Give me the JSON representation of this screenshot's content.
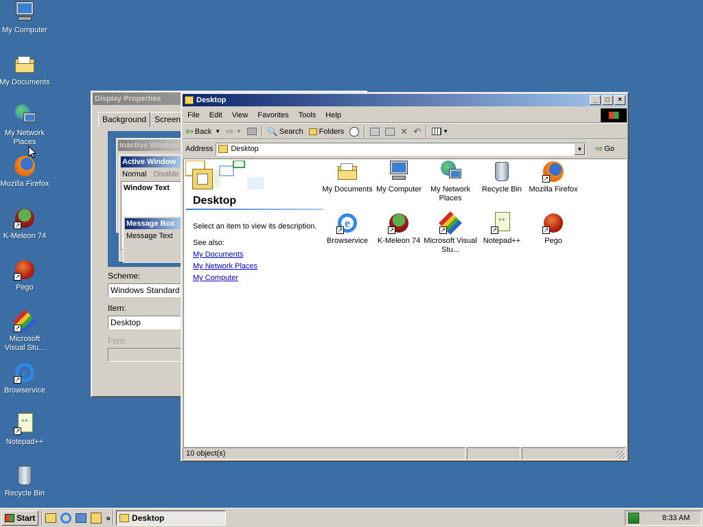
{
  "desktop_icons": [
    {
      "label": "My Computer",
      "icon": "computer-icon",
      "shortcut": false
    },
    {
      "label": "My Documents",
      "icon": "folder-icon",
      "shortcut": false
    },
    {
      "label": "My Network Places",
      "icon": "network-icon",
      "shortcut": false
    },
    {
      "label": "Mozilla Firefox",
      "icon": "firefox-icon",
      "shortcut": false
    },
    {
      "label": "K-Meleon 74",
      "icon": "kmeleon-icon",
      "shortcut": true
    },
    {
      "label": "Pego",
      "icon": "pego-icon",
      "shortcut": true
    },
    {
      "label": "Microsoft Visual Stu...",
      "icon": "visual-studio-icon",
      "shortcut": true
    },
    {
      "label": "Browservice",
      "icon": "ie-icon",
      "shortcut": true
    },
    {
      "label": "Notepad++",
      "icon": "notepad-icon",
      "shortcut": true
    },
    {
      "label": "Recycle Bin",
      "icon": "recycle-bin-icon",
      "shortcut": false
    }
  ],
  "display_props": {
    "title": "Display Properties",
    "tabs": [
      "Background",
      "Screen S"
    ],
    "preview": {
      "inactive_window": "Inactive Window",
      "active_window": "Active Window",
      "menu_normal": "Normal",
      "menu_disabled": "Disable",
      "window_text": "Window Text",
      "message_box": "Message Box",
      "message_text": "Message Text"
    },
    "scheme_label": "Scheme:",
    "scheme_value": "Windows Standard",
    "item_label": "Item:",
    "item_value": "Desktop",
    "font_label": "Font:"
  },
  "explorer": {
    "title": "Desktop",
    "menu": [
      "File",
      "Edit",
      "View",
      "Favorites",
      "Tools",
      "Help"
    ],
    "toolbar": {
      "back": "Back",
      "search": "Search",
      "folders": "Folders"
    },
    "address_label": "Address",
    "address_value": "Desktop",
    "go_label": "Go",
    "left_panel": {
      "heading": "Desktop",
      "description": "Select an item to view its description.",
      "see_also": "See also:",
      "links": [
        "My Documents",
        "My Network Places",
        "My Computer"
      ]
    },
    "items": [
      {
        "label": "My Documents",
        "icon": "folder-icon",
        "shortcut": false
      },
      {
        "label": "My Computer",
        "icon": "computer-icon",
        "shortcut": false
      },
      {
        "label": "My Network Places",
        "icon": "network-icon",
        "shortcut": false
      },
      {
        "label": "Recycle Bin",
        "icon": "recycle-bin-icon",
        "shortcut": false
      },
      {
        "label": "Mozilla Firefox",
        "icon": "firefox-icon",
        "shortcut": true
      },
      {
        "label": "Browservice",
        "icon": "ie-icon",
        "shortcut": true
      },
      {
        "label": "K-Meleon 74",
        "icon": "kmeleon-icon",
        "shortcut": true
      },
      {
        "label": "Microsoft Visual Stu...",
        "icon": "visual-studio-icon",
        "shortcut": true
      },
      {
        "label": "Notepad++",
        "icon": "notepad-icon",
        "shortcut": true
      },
      {
        "label": "Pego",
        "icon": "pego-icon",
        "shortcut": true
      }
    ],
    "status_text": "10 object(s)"
  },
  "taskbar": {
    "start_label": "Start",
    "task_button": "Desktop",
    "chevron": "»",
    "clock": "8:33 AM"
  },
  "colors": {
    "desktop": "#3a6ea5",
    "title_active": "#0a246a",
    "face": "#d4d0c8"
  }
}
